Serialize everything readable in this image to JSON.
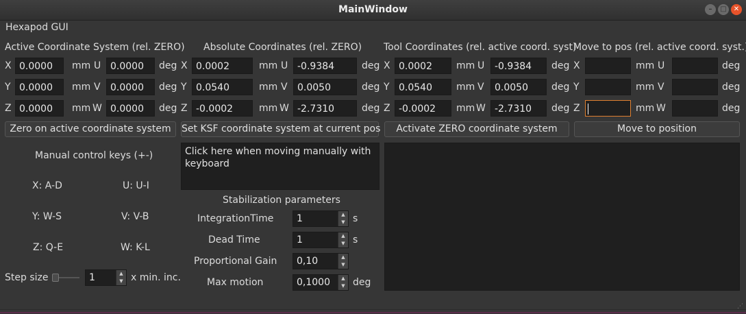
{
  "window": {
    "title": "MainWindow"
  },
  "menu": {
    "label": "Hexapod GUI"
  },
  "sections": {
    "active": "Active Coordinate System (rel. ZERO)",
    "absolute": "Absolute Coordinates (rel. ZERO)",
    "tool": "Tool Coordinates (rel. active coord. syst)",
    "move": "Move to pos (rel. active coord. syst.)"
  },
  "axes": {
    "x": "X",
    "y": "Y",
    "z": "Z",
    "u": "U",
    "v": "V",
    "w": "W"
  },
  "units": {
    "mm": "mm",
    "deg": "deg"
  },
  "active": {
    "x": "0.0000",
    "y": "0.0000",
    "z": "0.0000",
    "u": "0.0000",
    "v": "0.0000",
    "w": "0.0000"
  },
  "absolute": {
    "x": "0.0002",
    "y": "0.0540",
    "z": "-0.0002",
    "u": "-0.9384",
    "v": "0.0050",
    "w": "-2.7310"
  },
  "tool": {
    "x": "0.0002",
    "y": "0.0540",
    "z": "-0.0002",
    "u": "-0.9384",
    "v": "0.0050",
    "w": "-2.7310"
  },
  "move": {
    "x": "",
    "y": "",
    "z": "",
    "u": "",
    "v": "",
    "w": ""
  },
  "buttons": {
    "zero": "Zero on active coordinate system",
    "ksf": "Set KSF coordinate system at current pos",
    "activate": "Activate ZERO coordinate system",
    "move": "Move to position"
  },
  "manual": {
    "title": "Manual control keys (+-)",
    "x": "X: A-D",
    "u": "U: U-I",
    "y": "Y: W-S",
    "v": "V: V-B",
    "z": "Z: Q-E",
    "w": "W: K-L"
  },
  "step": {
    "label": "Step size",
    "value": "1",
    "suffix": "x min. inc.",
    "slider_level": 0
  },
  "keyboard_area": {
    "text": "Click here when moving manually with keyboard"
  },
  "stabilization": {
    "title": "Stabilization parameters",
    "integration_label": "IntegrationTime",
    "integration_value": "1",
    "integration_unit": "s",
    "dead_label": "Dead Time",
    "dead_value": "1",
    "dead_unit": "s",
    "gain_label": "Proportional Gain",
    "gain_value": "0,10",
    "motion_label": "Max motion",
    "motion_value": "0,1000",
    "motion_unit": "deg"
  }
}
